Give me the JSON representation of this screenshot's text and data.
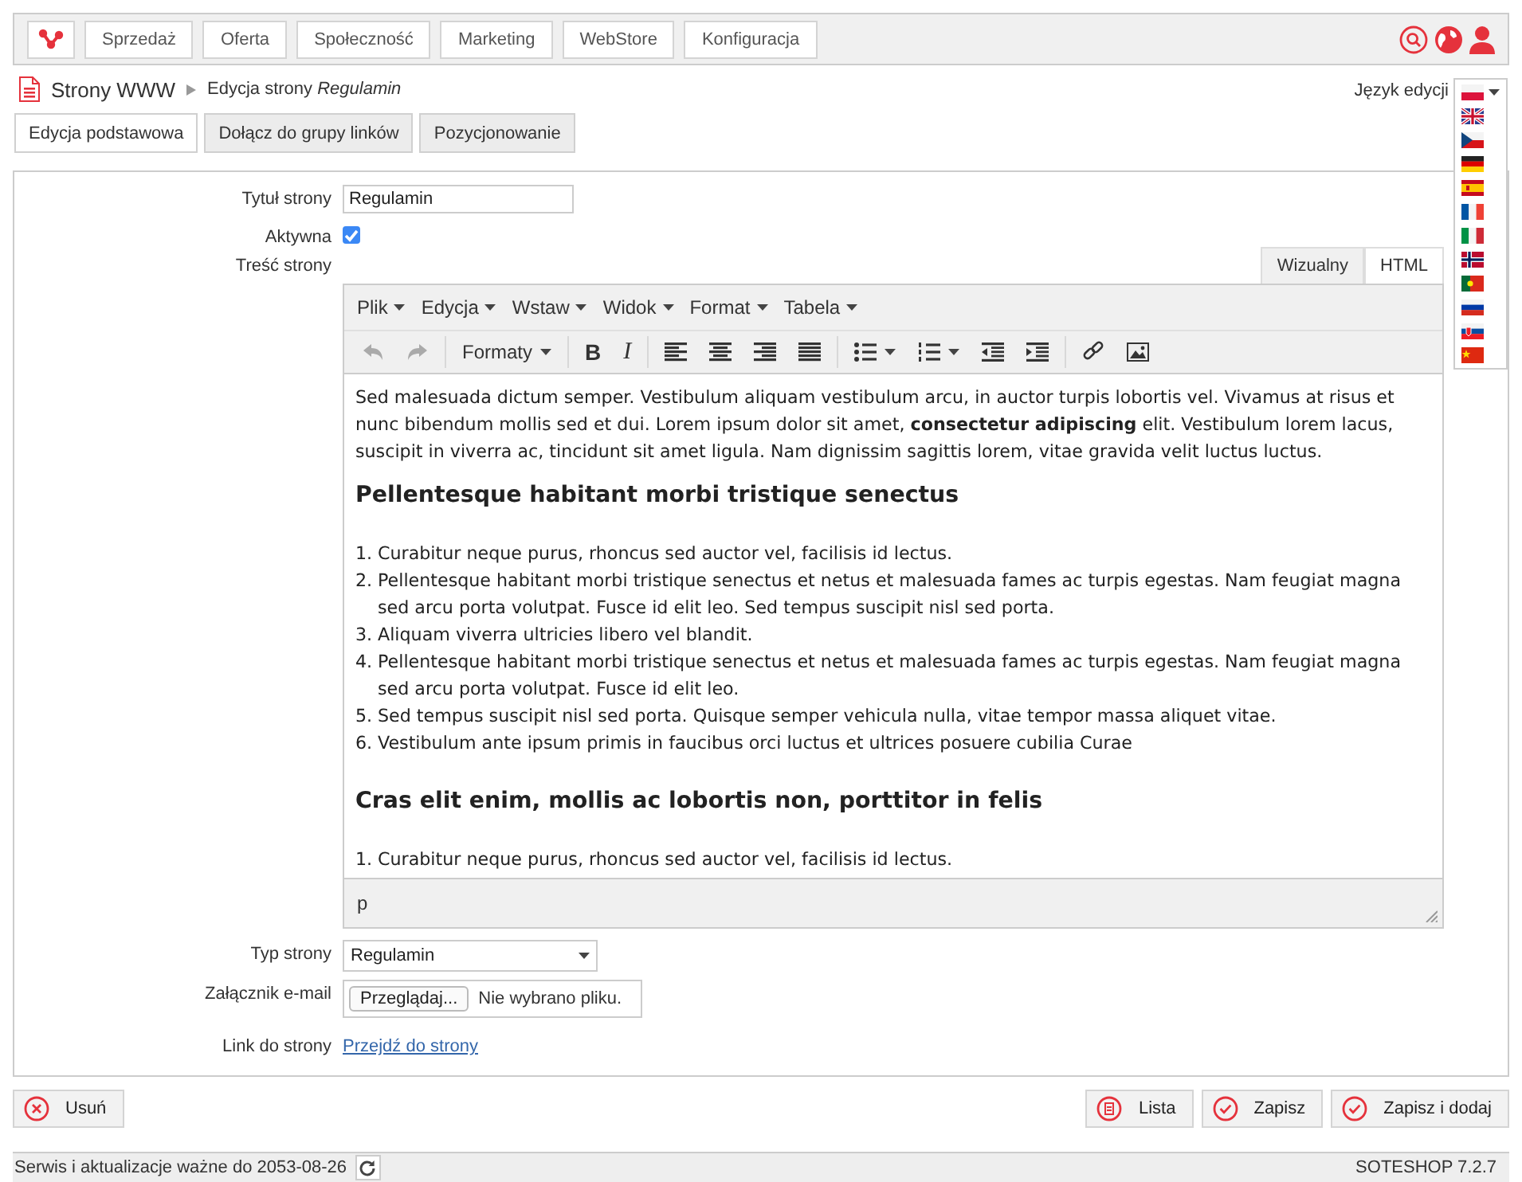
{
  "nav": {
    "items": [
      "Sprzedaż",
      "Oferta",
      "Społeczność",
      "Marketing",
      "WebStore",
      "Konfiguracja"
    ]
  },
  "breadcrumb": {
    "section": "Strony WWW",
    "page": "Edycja strony *Regulamin*"
  },
  "language": {
    "label": "Język edycji",
    "flags": [
      {
        "kind": "pl",
        "selected": true
      },
      {
        "kind": "gb",
        "selected": false
      },
      {
        "kind": "cz",
        "selected": false
      },
      {
        "kind": "de",
        "selected": false
      },
      {
        "kind": "es",
        "selected": false
      },
      {
        "kind": "fr",
        "selected": false
      },
      {
        "kind": "it",
        "selected": false
      },
      {
        "kind": "no",
        "selected": false
      },
      {
        "kind": "pt",
        "selected": false
      },
      {
        "kind": "ru",
        "selected": false
      },
      {
        "kind": "sk",
        "selected": false
      },
      {
        "kind": "cn",
        "selected": false
      }
    ]
  },
  "tabs": [
    {
      "label": "Edycja podstawowa",
      "selected": true
    },
    {
      "label": "Dołącz do grupy linków",
      "selected": false
    },
    {
      "label": "Pozycjonowanie",
      "selected": false
    }
  ],
  "form": {
    "title_label": "Tytuł strony",
    "title_value": "Regulamin",
    "active_label": "Aktywna",
    "active_checked": true,
    "content_label": "Treść strony",
    "editor": {
      "modes": [
        {
          "label": "Wizualny",
          "selected": true
        },
        {
          "label": "HTML",
          "selected": false
        }
      ],
      "menu": [
        "Plik",
        "Edycja",
        "Wstaw",
        "Widok",
        "Format",
        "Tabela"
      ],
      "toolbar": [
        {
          "kind": "undo",
          "disabled": true
        },
        {
          "kind": "redo",
          "disabled": true
        },
        {
          "kind": "separator"
        },
        {
          "kind": "formats",
          "label": "Formaty"
        },
        {
          "kind": "separator"
        },
        {
          "kind": "bold",
          "label": "B"
        },
        {
          "kind": "italic",
          "label": "I"
        },
        {
          "kind": "separator"
        },
        {
          "kind": "align-left"
        },
        {
          "kind": "align-center"
        },
        {
          "kind": "align-right"
        },
        {
          "kind": "justify"
        },
        {
          "kind": "separator"
        },
        {
          "kind": "bullet-list"
        },
        {
          "kind": "numbered-list"
        },
        {
          "kind": "outdent"
        },
        {
          "kind": "indent"
        },
        {
          "kind": "separator"
        },
        {
          "kind": "link"
        },
        {
          "kind": "image"
        }
      ],
      "content": [
        {
          "kind": "paragraph",
          "text": "Sed malesuada dictum semper. Vestibulum aliquam vestibulum arcu, in auctor turpis lobortis vel. Vivamus at risus et nunc bibendum mollis sed et dui. Lorem ipsum dolor sit amet, **consectetur adipiscing** elit. Vestibulum lorem lacus, suscipit in viverra ac, tincidunt sit amet ligula. Nam dignissim sagittis lorem, vitae gravida velit luctus luctus."
        },
        {
          "kind": "heading",
          "text": "Pellentesque habitant morbi tristique senectus"
        },
        {
          "kind": "ordered_list",
          "items": [
            {
              "number": "1.",
              "text": "Curabitur neque purus, rhoncus sed auctor vel, facilisis id lectus."
            },
            {
              "number": "2.",
              "text": "Pellentesque habitant morbi tristique senectus et netus et malesuada fames ac turpis egestas. Nam feugiat magna sed arcu porta volutpat. Fusce id elit leo. Sed tempus suscipit nisl sed porta."
            },
            {
              "number": "3.",
              "text": "Aliquam viverra ultricies libero vel blandit."
            },
            {
              "number": "4.",
              "text": "Pellentesque habitant morbi tristique senectus et netus et malesuada fames ac turpis egestas. Nam feugiat magna sed arcu porta volutpat. Fusce id elit leo."
            },
            {
              "number": "5.",
              "text": "Sed tempus suscipit nisl sed porta. Quisque semper vehicula nulla, vitae tempor massa aliquet vitae."
            },
            {
              "number": "6.",
              "text": "Vestibulum ante ipsum primis in faucibus orci luctus et ultrices posuere cubilia Curae"
            }
          ]
        },
        {
          "kind": "heading",
          "text": "Cras elit enim, mollis ac lobortis non, porttitor in felis"
        },
        {
          "kind": "ordered_list",
          "items": [
            {
              "number": "1.",
              "text": "Curabitur neque purus, rhoncus sed auctor vel, facilisis id lectus."
            }
          ]
        }
      ],
      "path": "p"
    },
    "type_label": "Typ strony",
    "type_value": "Regulamin",
    "attachment_label": "Załącznik e-mail",
    "browse_button": "Przeglądaj...",
    "file_status": "Nie wybrano pliku.",
    "link_label": "Link do strony",
    "link_text": "Przejdź do strony"
  },
  "actions": {
    "left": [
      {
        "kind": "delete",
        "label": "Usuń"
      }
    ],
    "right": [
      {
        "kind": "list",
        "label": "Lista"
      },
      {
        "kind": "save",
        "label": "Zapisz"
      },
      {
        "kind": "save",
        "label": "Zapisz i dodaj"
      }
    ]
  },
  "status": {
    "text": "Serwis i aktualizacje ważne do 2053-08-26",
    "version": "SOTESHOP 7.2.7"
  }
}
